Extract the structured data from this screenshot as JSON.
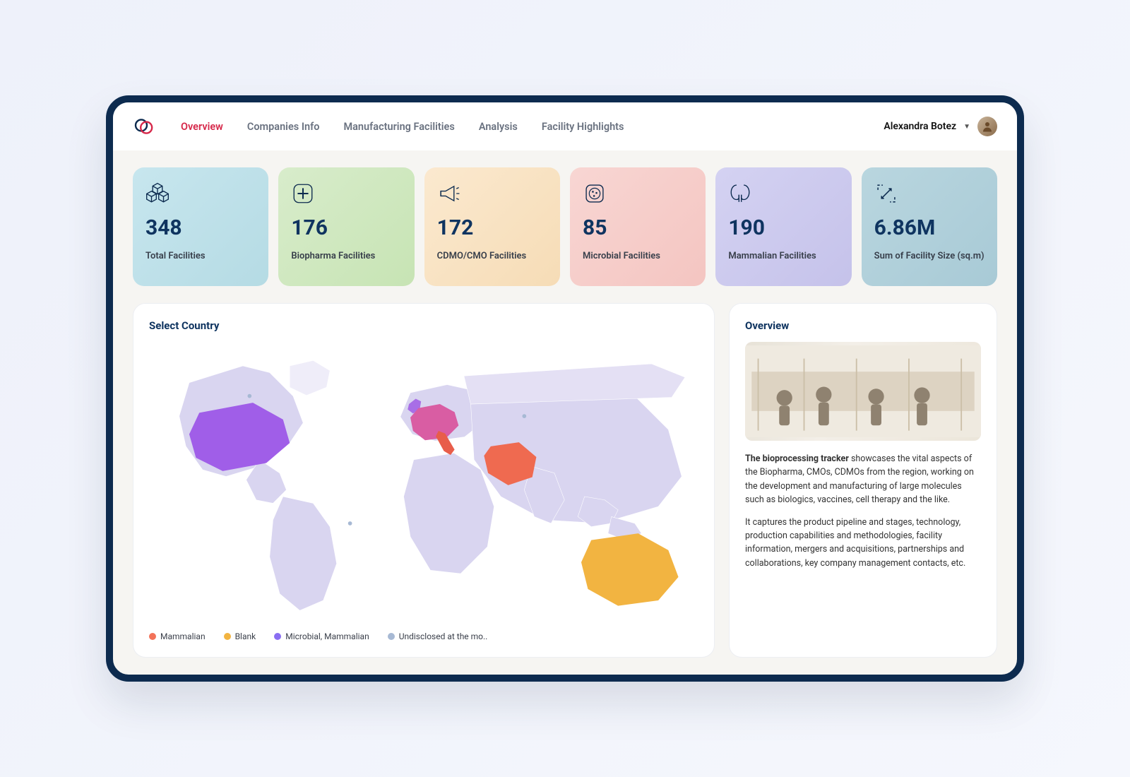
{
  "nav": {
    "items": [
      {
        "label": "Overview",
        "active": true
      },
      {
        "label": "Companies Info",
        "active": false
      },
      {
        "label": "Manufacturing Facilities",
        "active": false
      },
      {
        "label": "Analysis",
        "active": false
      },
      {
        "label": "Facility Highlights",
        "active": false
      }
    ]
  },
  "user": {
    "name": "Alexandra Botez"
  },
  "cards": [
    {
      "value": "348",
      "label": "Total Facilities",
      "bg": "linear-gradient(135deg,#c7e6ee,#b5dbe4)",
      "icon": "cubes"
    },
    {
      "value": "176",
      "label": "Biopharma Facilities",
      "bg": "linear-gradient(135deg,#d8eccb,#c7e4b4)",
      "icon": "medical"
    },
    {
      "value": "172",
      "label": "CDMO/CMO Facilities",
      "bg": "linear-gradient(135deg,#fbe9cf,#f6dcb6)",
      "icon": "megaphone"
    },
    {
      "value": "85",
      "label": "Microbial Facilities",
      "bg": "linear-gradient(135deg,#f8d6d3,#f4c5c1)",
      "icon": "microbe"
    },
    {
      "value": "190",
      "label": "Mammalian Facilities",
      "bg": "linear-gradient(135deg,#d4d2f2,#c5c2ea)",
      "icon": "kidneys"
    },
    {
      "value": "6.86M",
      "label": "Sum of Facility Size (sq.m)",
      "bg": "linear-gradient(135deg,#b9d6df,#a8cad6)",
      "icon": "expand"
    }
  ],
  "map": {
    "title": "Select Country",
    "legend": [
      {
        "label": "Mammalian",
        "color": "#f27259"
      },
      {
        "label": "Blank",
        "color": "#f2b441"
      },
      {
        "label": "Microbial, Mammalian",
        "color": "#8a6ef2"
      },
      {
        "label": "Undisclosed at the mo..",
        "color": "#a7b9d4"
      }
    ]
  },
  "overview": {
    "title": "Overview",
    "p1_bold": "The bioprocessing tracker",
    "p1_rest": " showcases the vital aspects of the Biopharma, CMOs, CDMOs from the region, working on the development and manufacturing of large molecules  such as biologics, vaccines, cell therapy and the like.",
    "p2": "It captures the product pipeline and stages, technology, production capabilities and methodologies, facility information, mergers and acquisitions, partnerships and collaborations, key company management contacts, etc."
  },
  "colors": {
    "accent": "#d6284a",
    "navy": "#0f3460",
    "frame": "#0d2b4f"
  }
}
